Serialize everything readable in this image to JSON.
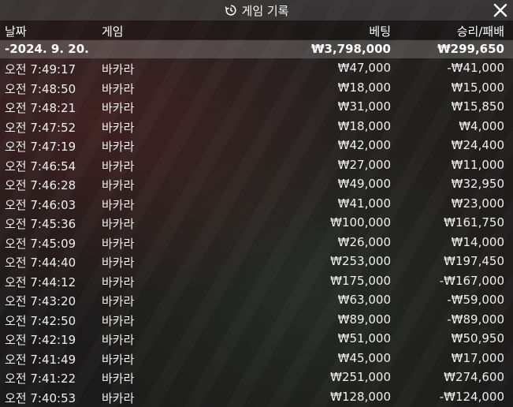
{
  "window": {
    "title": "게임 기록",
    "title_icon": "history-icon",
    "close_icon": "close-icon"
  },
  "columns": {
    "date": "날짜",
    "game": "게임",
    "bet": "베팅",
    "winloss": "승리/패배"
  },
  "summary": {
    "date": "-2024. 9. 20.",
    "bet": "₩3,798,000",
    "winloss": "₩299,650"
  },
  "rows": [
    {
      "time": "오전 7:49:17",
      "game": "바카라",
      "bet": "₩47,000",
      "winloss": "-₩41,000"
    },
    {
      "time": "오전 7:48:50",
      "game": "바카라",
      "bet": "₩18,000",
      "winloss": "₩15,000"
    },
    {
      "time": "오전 7:48:21",
      "game": "바카라",
      "bet": "₩31,000",
      "winloss": "₩15,850"
    },
    {
      "time": "오전 7:47:52",
      "game": "바카라",
      "bet": "₩18,000",
      "winloss": "₩4,000"
    },
    {
      "time": "오전 7:47:19",
      "game": "바카라",
      "bet": "₩42,000",
      "winloss": "₩24,400"
    },
    {
      "time": "오전 7:46:54",
      "game": "바카라",
      "bet": "₩27,000",
      "winloss": "₩11,000"
    },
    {
      "time": "오전 7:46:28",
      "game": "바카라",
      "bet": "₩49,000",
      "winloss": "₩32,950"
    },
    {
      "time": "오전 7:46:03",
      "game": "바카라",
      "bet": "₩41,000",
      "winloss": "₩23,000"
    },
    {
      "time": "오전 7:45:36",
      "game": "바카라",
      "bet": "₩100,000",
      "winloss": "₩161,750"
    },
    {
      "time": "오전 7:45:09",
      "game": "바카라",
      "bet": "₩26,000",
      "winloss": "₩14,000"
    },
    {
      "time": "오전 7:44:40",
      "game": "바카라",
      "bet": "₩253,000",
      "winloss": "₩197,450"
    },
    {
      "time": "오전 7:44:12",
      "game": "바카라",
      "bet": "₩175,000",
      "winloss": "-₩167,000"
    },
    {
      "time": "오전 7:43:20",
      "game": "바카라",
      "bet": "₩63,000",
      "winloss": "-₩59,000"
    },
    {
      "time": "오전 7:42:50",
      "game": "바카라",
      "bet": "₩89,000",
      "winloss": "-₩89,000"
    },
    {
      "time": "오전 7:42:19",
      "game": "바카라",
      "bet": "₩51,000",
      "winloss": "₩50,950"
    },
    {
      "time": "오전 7:41:49",
      "game": "바카라",
      "bet": "₩45,000",
      "winloss": "₩17,000"
    },
    {
      "time": "오전 7:41:22",
      "game": "바카라",
      "bet": "₩251,000",
      "winloss": "₩274,600"
    },
    {
      "time": "오전 7:40:53",
      "game": "바카라",
      "bet": "₩128,000",
      "winloss": "-₩124,000"
    }
  ]
}
